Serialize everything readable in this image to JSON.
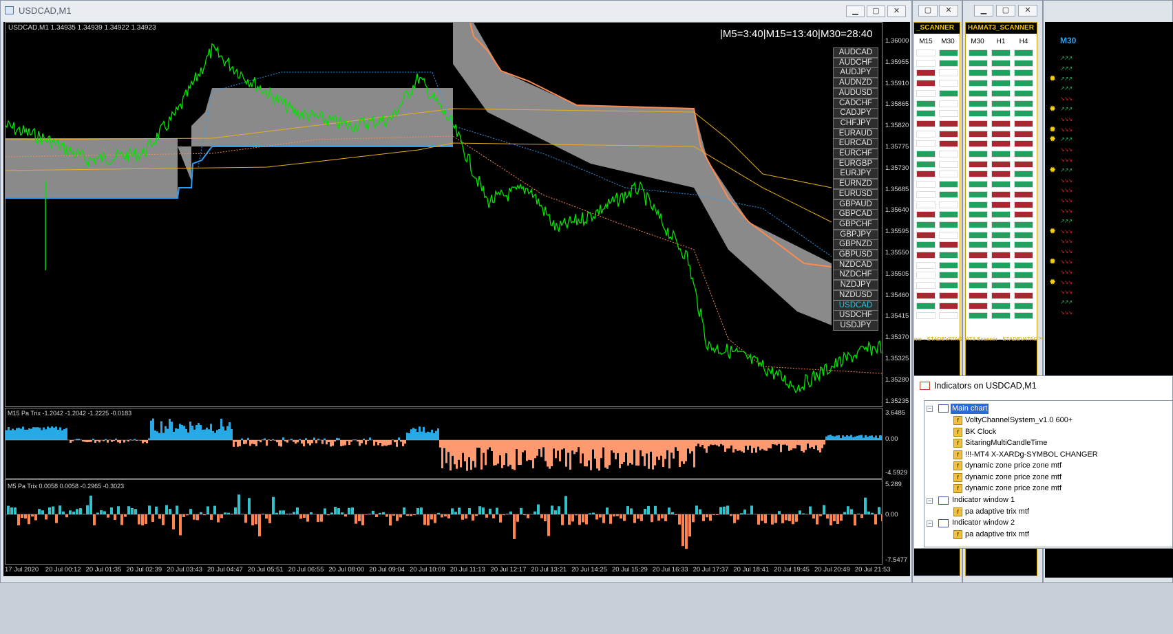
{
  "window": {
    "title": "USDCAD,M1",
    "minimize_icon": "minimize-icon",
    "restore_icon": "restore-icon",
    "close_icon": "close-icon"
  },
  "chart": {
    "header": "USDCAD,M1  1.34935 1.34939 1.34922 1.34923",
    "clock": "|M5=3:40|M15=13:40|M30=28:40",
    "price_labels": [
      "1.36000",
      "1.35955",
      "1.35910",
      "1.35865",
      "1.35820",
      "1.35775",
      "1.35730",
      "1.35685",
      "1.35640",
      "1.35595",
      "1.35550",
      "1.35505",
      "1.35460",
      "1.35415",
      "1.35370",
      "1.35325",
      "1.35280",
      "1.35235"
    ],
    "symbols": [
      "AUDCAD",
      "AUDCHF",
      "AUDJPY",
      "AUDNZD",
      "AUDUSD",
      "CADCHF",
      "CADJPY",
      "CHFJPY",
      "EURAUD",
      "EURCAD",
      "EURCHF",
      "EURGBP",
      "EURJPY",
      "EURNZD",
      "EURUSD",
      "GBPAUD",
      "GBPCAD",
      "GBPCHF",
      "GBPJPY",
      "GBPNZD",
      "GBPUSD",
      "NZDCAD",
      "NZDCHF",
      "NZDJPY",
      "NZDUSD",
      "USDCAD",
      "USDCHF",
      "USDJPY"
    ],
    "active_symbol": "USDCAD",
    "sub1": {
      "title": "M15 Pa Trix -1.2042 -1.2042 -1.2225 -0.0183",
      "labels": [
        "3.6485",
        "0.00",
        "-4.5929"
      ]
    },
    "sub2": {
      "title": "M5 Pa Trix 0.0058 0.0058 -0.2965 -0.3023",
      "labels": [
        "5.289",
        "0.00",
        "-7.5477"
      ]
    },
    "time_labels": [
      "17 Jul 2020",
      "20 Jul 00:12",
      "20 Jul 01:35",
      "20 Jul 02:39",
      "20 Jul 03:43",
      "20 Jul 04:47",
      "20 Jul 05:51",
      "20 Jul 06:55",
      "20 Jul 08:00",
      "20 Jul 09:04",
      "20 Jul 10:09",
      "20 Jul 11:13",
      "20 Jul 12:17",
      "20 Jul 13:21",
      "20 Jul 14:25",
      "20 Jul 15:29",
      "20 Jul 16:33",
      "20 Jul 17:37",
      "20 Jul 18:41",
      "20 Jul 19:45",
      "20 Jul 20:49",
      "20 Jul 21:53"
    ]
  },
  "scanner1": {
    "title": "_SCANNER",
    "cols": [
      "M15",
      "M30"
    ],
    "footer": "ner - STADEVATAG",
    "rows": [
      [
        "w",
        "g"
      ],
      [
        "w",
        "g"
      ],
      [
        "r",
        "w"
      ],
      [
        "r",
        "w"
      ],
      [
        "w",
        "g"
      ],
      [
        "g",
        "w"
      ],
      [
        "g",
        "w"
      ],
      [
        "r",
        "r"
      ],
      [
        "w",
        "r"
      ],
      [
        "w",
        "r"
      ],
      [
        "g",
        "w"
      ],
      [
        "g",
        "w"
      ],
      [
        "r",
        "w"
      ],
      [
        "w",
        "g"
      ],
      [
        "w",
        "g"
      ],
      [
        "w",
        "w"
      ],
      [
        "r",
        "g"
      ],
      [
        "g",
        "g"
      ],
      [
        "r",
        "w"
      ],
      [
        "g",
        "r"
      ],
      [
        "r",
        "g"
      ],
      [
        "w",
        "g"
      ],
      [
        "w",
        "g"
      ],
      [
        "w",
        "g"
      ],
      [
        "r",
        "r"
      ],
      [
        "g",
        "r"
      ],
      [
        "w",
        "w"
      ]
    ]
  },
  "scanner2": {
    "title": "HAMAT3_SCANNER",
    "cols": [
      "M30",
      "H1",
      "H4"
    ],
    "footer": "AT3 Scanner - STADEVATAG™",
    "rows": [
      [
        "g",
        "g",
        "g"
      ],
      [
        "g",
        "g",
        "g"
      ],
      [
        "g",
        "g",
        "g"
      ],
      [
        "g",
        "g",
        "g"
      ],
      [
        "g",
        "g",
        "g"
      ],
      [
        "g",
        "g",
        "g"
      ],
      [
        "g",
        "g",
        "g"
      ],
      [
        "r",
        "r",
        "r"
      ],
      [
        "r",
        "r",
        "r"
      ],
      [
        "r",
        "r",
        "r"
      ],
      [
        "g",
        "g",
        "g"
      ],
      [
        "r",
        "r",
        "r"
      ],
      [
        "r",
        "r",
        "g"
      ],
      [
        "g",
        "g",
        "g"
      ],
      [
        "g",
        "r",
        "r"
      ],
      [
        "g",
        "r",
        "r"
      ],
      [
        "g",
        "g",
        "r"
      ],
      [
        "g",
        "g",
        "g"
      ],
      [
        "g",
        "g",
        "g"
      ],
      [
        "g",
        "g",
        "g"
      ],
      [
        "r",
        "r",
        "r"
      ],
      [
        "g",
        "g",
        "g"
      ],
      [
        "g",
        "g",
        "g"
      ],
      [
        "g",
        "g",
        "g"
      ],
      [
        "r",
        "r",
        "r"
      ],
      [
        "r",
        "g",
        "g"
      ],
      [
        "g",
        "g",
        "g"
      ]
    ]
  },
  "right_panel": {
    "label": "M30"
  },
  "indicators": {
    "title": "Indicators on USDCAD,M1",
    "main_chart": "Main chart",
    "main_items": [
      "VoltyChannelSystem_v1.0 600+",
      "BK Clock",
      "SitaringMultiCandleTime",
      "!!!-MT4 X-XARDg-SYMBOL CHANGER",
      "dynamic zone price zone mtf",
      "dynamic zone price zone mtf",
      "dynamic zone price zone mtf"
    ],
    "window1": "Indicator window 1",
    "window1_items": [
      "pa adaptive trix mtf"
    ],
    "window2": "Indicator window 2",
    "window2_items": [
      "pa adaptive trix mtf"
    ]
  },
  "colors": {
    "price": "#00e400",
    "channel": "#8a8a8a",
    "orange": "#ff8a50",
    "blue": "#2a9df4",
    "yellow": "#e8b020"
  }
}
